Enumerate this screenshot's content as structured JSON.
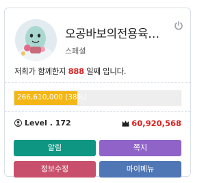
{
  "profile": {
    "username": "오공바보의전용육…",
    "level_name": "스페셜",
    "days_prefix": "저희가 함께한지 ",
    "days_count": "888",
    "days_suffix": " 일째 입니다."
  },
  "experience": {
    "label": "266,610,000 (38%)",
    "percent": 38
  },
  "stats": {
    "level_label": "Level . 172",
    "points": "60,920,568"
  },
  "buttons": {
    "alarm": "알림",
    "message": "쪽지",
    "edit_profile": "정보수정",
    "my_menu": "마이메뉴"
  },
  "colors": {
    "accent_red": "#d92020",
    "xp_fill": "#f3b615",
    "alarm_button": "#0f9683",
    "message_button": "#8f63c7",
    "edit_button": "#c9506c",
    "mymenu_button": "#4f76b5"
  },
  "icons": {
    "logout": "power-icon",
    "level": "user-icon",
    "points": "crown-icon"
  }
}
